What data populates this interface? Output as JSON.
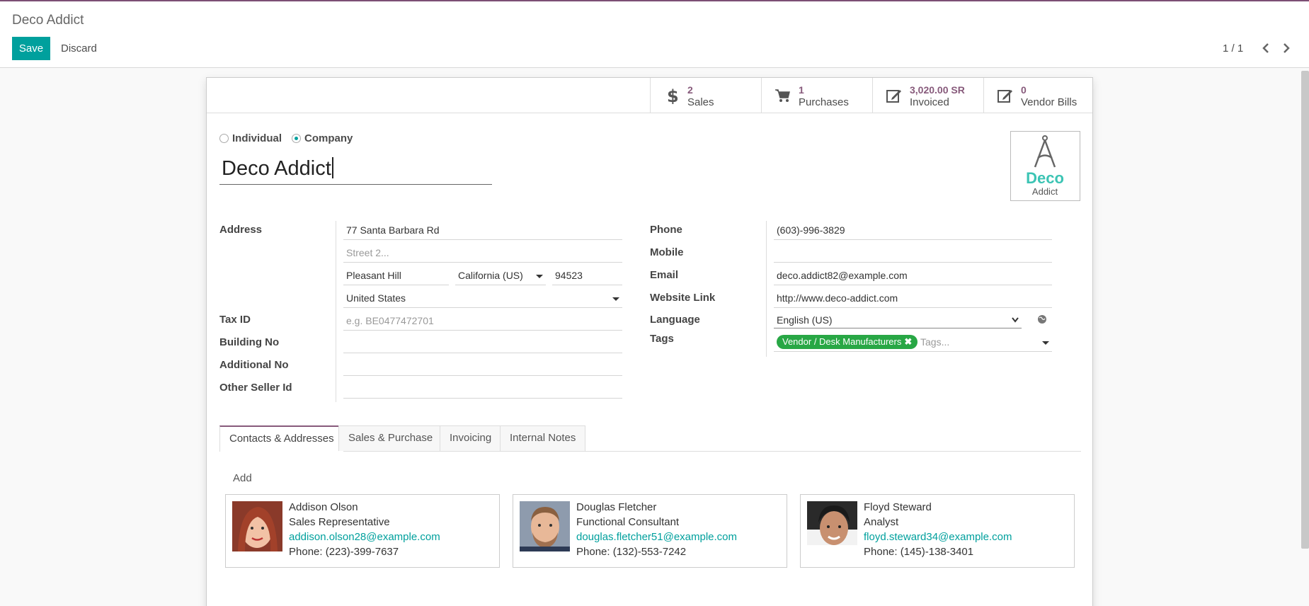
{
  "header": {
    "breadcrumb": "Deco Addict",
    "save_label": "Save",
    "discard_label": "Discard",
    "pager": "1 / 1"
  },
  "smart_buttons": [
    {
      "value": "2",
      "label": "Sales",
      "icon": "dollar-icon"
    },
    {
      "value": "1",
      "label": "Purchases",
      "icon": "cart-icon"
    },
    {
      "value": "3,020.00 SR",
      "label": "Invoiced",
      "icon": "edit-icon"
    },
    {
      "value": "0",
      "label": "Vendor Bills",
      "icon": "edit-icon"
    }
  ],
  "company_type": {
    "individual": "Individual",
    "company": "Company",
    "selected": "Company"
  },
  "name": "Deco Addict",
  "logo": {
    "line1": "Deco",
    "line2": "Addict"
  },
  "left_fields": {
    "address_label": "Address",
    "street": "77 Santa Barbara Rd",
    "street2_placeholder": "Street 2...",
    "city": "Pleasant Hill",
    "state": "California (US)",
    "zip": "94523",
    "country": "United States",
    "taxid_label": "Tax ID",
    "taxid_placeholder": "e.g. BE0477472701",
    "building_label": "Building No",
    "additional_label": "Additional No",
    "seller_label": "Other Seller Id"
  },
  "right_fields": {
    "phone_label": "Phone",
    "phone": "(603)-996-3829",
    "mobile_label": "Mobile",
    "email_label": "Email",
    "email": "deco.addict82@example.com",
    "website_label": "Website Link",
    "website": "http://www.deco-addict.com",
    "language_label": "Language",
    "language": "English (US)",
    "tags_label": "Tags",
    "tag": "Vendor / Desk Manufacturers",
    "tags_placeholder": "Tags..."
  },
  "tabs": [
    {
      "label": "Contacts & Addresses",
      "active": true
    },
    {
      "label": "Sales & Purchase"
    },
    {
      "label": "Invoicing"
    },
    {
      "label": "Internal Notes"
    }
  ],
  "add_label": "Add",
  "contacts": [
    {
      "name": "Addison Olson",
      "job": "Sales Representative",
      "email": "addison.olson28@example.com",
      "phone": "Phone: (223)-399-7637"
    },
    {
      "name": "Douglas Fletcher",
      "job": "Functional Consultant",
      "email": "douglas.fletcher51@example.com",
      "phone": "Phone: (132)-553-7242"
    },
    {
      "name": "Floyd Steward",
      "job": "Analyst",
      "email": "floyd.steward34@example.com",
      "phone": "Phone: (145)-138-3401"
    }
  ],
  "colors": {
    "accent": "#00a09d",
    "brand": "#875a7b",
    "tag": "#28a745"
  }
}
